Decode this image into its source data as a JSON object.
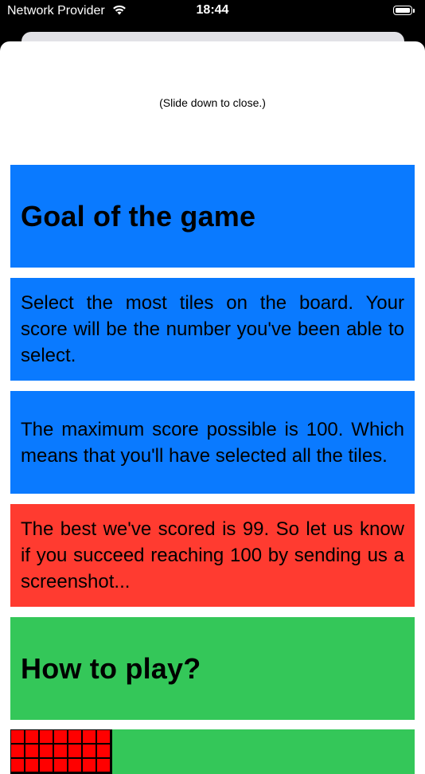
{
  "status_bar": {
    "carrier": "Network Provider",
    "time": "18:44",
    "wifi_icon": "wifi-icon",
    "battery_icon": "battery-icon"
  },
  "sheet": {
    "hint": "(Slide down to close.)"
  },
  "cards": [
    {
      "kind": "heading",
      "text": "Goal of the game",
      "color": "#0A7AFF"
    },
    {
      "kind": "paragraph",
      "text": "Select the most tiles on the board. Your score will be the number you've been able to select.",
      "color": "#0A7AFF"
    },
    {
      "kind": "paragraph",
      "text": "The maximum score possible is 100. Which means that you'll have selected all the tiles.",
      "color": "#0A7AFF"
    },
    {
      "kind": "paragraph",
      "text": "The best we've scored is 99. So let us know if you succeed reaching 100 by sending us a screenshot...",
      "color": "#FF3B30"
    },
    {
      "kind": "heading",
      "text": "How to play?",
      "color": "#34C759"
    }
  ],
  "board_preview": {
    "background_color": "#34C759",
    "tile_color": "#FF0000",
    "tile_count": 21
  }
}
